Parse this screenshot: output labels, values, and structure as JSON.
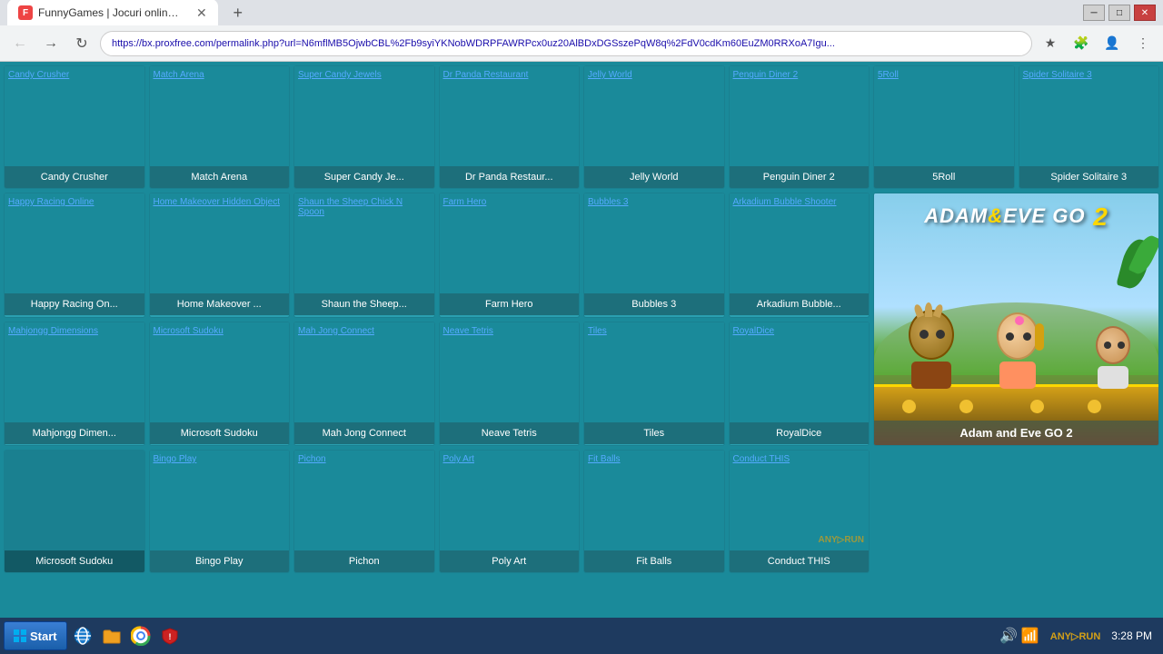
{
  "browser": {
    "tab_title": "FunnyGames | Jocuri online gratuite!",
    "url": "https://bx.proxfree.com/permalink.php?url=N6mflMB5OjwbCBL%2Fb9syiYKNobWDRPFAWRPcx0uz20AlBDxDGSszePqW8q%2FdV0cdKm60EuZM0RRXoA7Igu...",
    "nav": {
      "back": "←",
      "forward": "→",
      "refresh": "↻"
    }
  },
  "games": [
    {
      "id": "candy-crusher",
      "label": "Candy Crusher",
      "alt": "Candy Crusher"
    },
    {
      "id": "match-arena",
      "label": "Match Arena",
      "alt": "Match Arena"
    },
    {
      "id": "super-candy-jewels",
      "label": "Super Candy Je...",
      "alt": "Super Candy Jewels"
    },
    {
      "id": "dr-panda-restaurant",
      "label": "Dr Panda Restaur...",
      "alt": "Dr Panda Restaurant"
    },
    {
      "id": "jelly-world",
      "label": "Jelly World",
      "alt": "Jelly World"
    },
    {
      "id": "penguin-diner-2",
      "label": "Penguin Diner 2",
      "alt": "Penguin Diner 2"
    },
    {
      "id": "5roll",
      "label": "5Roll",
      "alt": "5Roll"
    },
    {
      "id": "spider-solitaire-3",
      "label": "Spider Solitaire 3",
      "alt": "Spider Solitaire 3"
    },
    {
      "id": "happy-racing-online",
      "label": "Happy Racing On...",
      "alt": "Happy Racing Online"
    },
    {
      "id": "home-makeover",
      "label": "Home Makeover ...",
      "alt": "Home Makeover Hidden Object"
    },
    {
      "id": "shaun-sheep",
      "label": "Shaun the Sheep...",
      "alt": "Shaun the Sheep Chick N Spoon"
    },
    {
      "id": "farm-hero",
      "label": "Farm Hero",
      "alt": "Farm Hero"
    },
    {
      "id": "bubbles-3",
      "label": "Bubbles 3",
      "alt": "Bubbles 3"
    },
    {
      "id": "arkadium-bubble",
      "label": "Arkadium Bubble...",
      "alt": "Arkadium Bubble Shooter"
    },
    {
      "id": "mahjongg-dimensions",
      "label": "Mahjongg Dimen...",
      "alt": "Mahjongg Dimensions"
    },
    {
      "id": "microsoft-sudoku",
      "label": "Microsoft Sudoku",
      "alt": "Microsoft Sudoku"
    },
    {
      "id": "mah-jong-connect",
      "label": "Mah Jong Connect",
      "alt": "Mah Jong Connect"
    },
    {
      "id": "neave-tetris",
      "label": "Neave Tetris",
      "alt": "Neave Tetris"
    },
    {
      "id": "tiles",
      "label": "Tiles",
      "alt": "Tiles"
    },
    {
      "id": "royaldice",
      "label": "RoyalDice",
      "alt": "RoyalDice"
    },
    {
      "id": "bingo-play",
      "label": "Bingo Play",
      "alt": "Bingo Play"
    },
    {
      "id": "pichon",
      "label": "Pichon",
      "alt": "Pichon"
    },
    {
      "id": "poly-art",
      "label": "Poly Art",
      "alt": "Poly Art"
    },
    {
      "id": "fit-balls",
      "label": "Fit Balls",
      "alt": "Fit Balls"
    },
    {
      "id": "conduct-this",
      "label": "Conduct THIS",
      "alt": "Conduct THIS"
    }
  ],
  "featured_game": {
    "id": "adam-eve-go-2",
    "label": "Adam and Eve GO 2",
    "title1": "ADAM",
    "title_amp": "&",
    "title2": "EVE GO",
    "title_num": "2"
  },
  "taskbar": {
    "start": "Start",
    "time": "3:28 PM",
    "anyrun": "ANY▷RUN"
  }
}
